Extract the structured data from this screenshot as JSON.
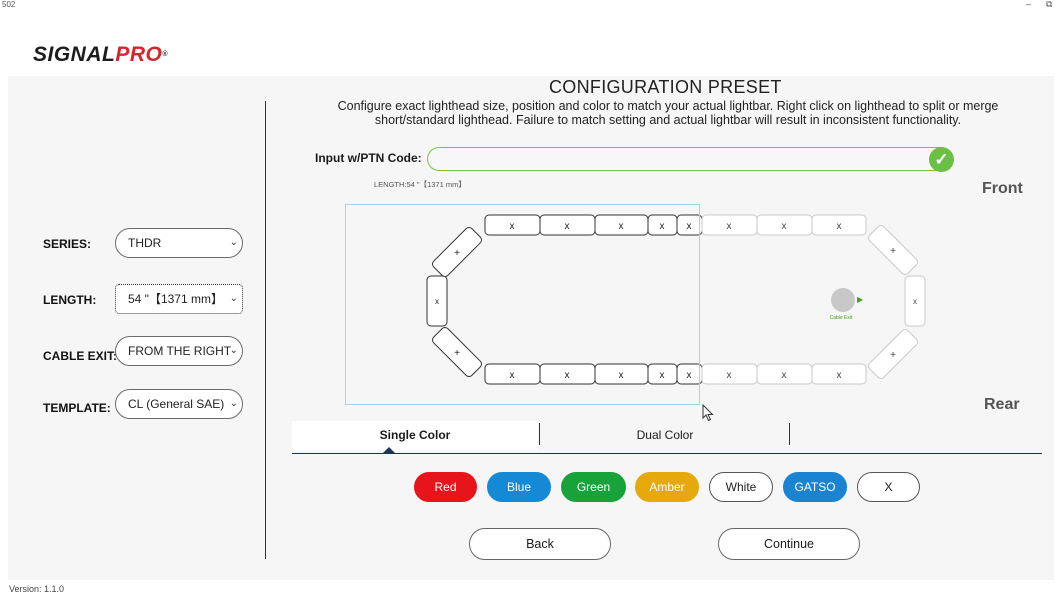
{
  "window": {
    "title": "502",
    "minimize": "–",
    "maximize": "⧉"
  },
  "logo": {
    "part1": "SIGNAL",
    "part2": "PRO",
    "reg": "®"
  },
  "sidebar": {
    "series": {
      "label": "SERIES:",
      "value": "THDR"
    },
    "length": {
      "label": "LENGTH:",
      "value": "54 \"【1371 mm】"
    },
    "cable_exit": {
      "label": "CABLE EXIT:",
      "value": "FROM THE RIGHT"
    },
    "template": {
      "label": "TEMPLATE:",
      "value": "CL (General SAE)"
    }
  },
  "main": {
    "title": "CONFIGURATION PRESET",
    "instructions": "Configure exact lighthead size, position and color to match your actual lightbar. Right click on lighthead to split or merge short/standard lighthead. Failure to match setting and actual lightbar will result in inconsistent functionality.",
    "ptn_label": "Input w/PTN Code:",
    "ptn_value": "",
    "length_caption": "LENGTH:54 \"【1371 mm】",
    "front_label": "Front",
    "rear_label": "Rear",
    "cable_exit_label": "Cable Exit"
  },
  "lightbar": {
    "head_mark": "x",
    "corner_mark": "+"
  },
  "tabs": {
    "single": "Single Color",
    "dual": "Dual Color"
  },
  "colors": {
    "red": {
      "label": "Red",
      "hex": "#e8141c"
    },
    "blue": {
      "label": "Blue",
      "hex": "#1689d4"
    },
    "green": {
      "label": "Green",
      "hex": "#18a33a"
    },
    "amber": {
      "label": "Amber",
      "hex": "#e6a90b"
    },
    "white": {
      "label": "White",
      "hex": "#ffffff"
    },
    "gatso": {
      "label": "GATSO",
      "hex": "#1a84d3"
    },
    "clear": {
      "label": "X",
      "hex": "#ffffff"
    }
  },
  "nav": {
    "back": "Back",
    "continue": "Continue"
  },
  "version": "Version: 1.1.0"
}
